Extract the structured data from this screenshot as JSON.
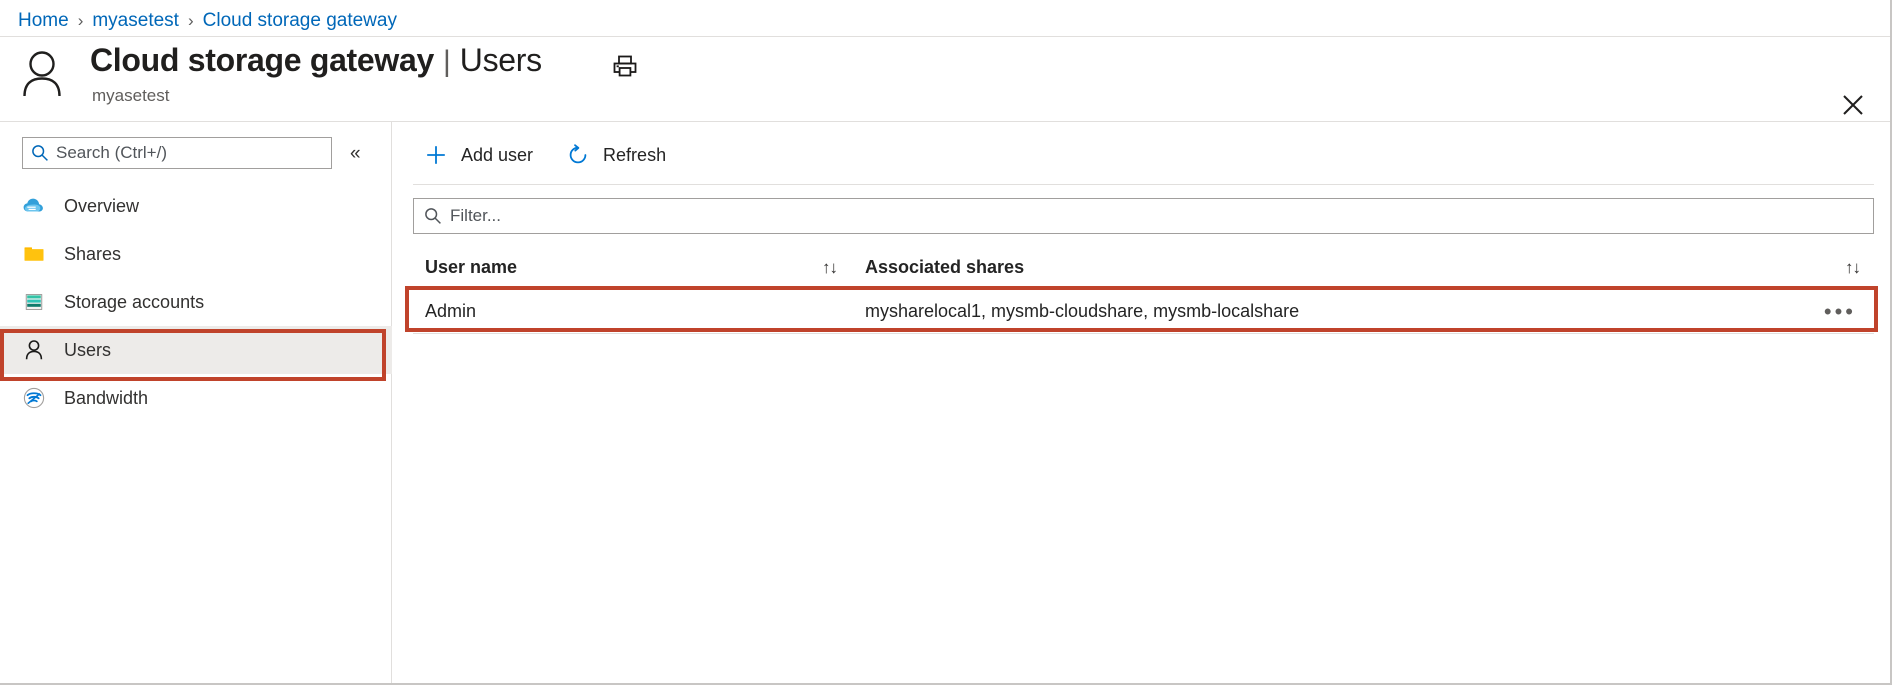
{
  "breadcrumb": {
    "items": [
      {
        "label": "Home"
      },
      {
        "label": "myasetest"
      },
      {
        "label": "Cloud storage gateway"
      }
    ],
    "separator": "›"
  },
  "header": {
    "avatar_icon": "user-icon",
    "title": "Cloud storage gateway",
    "pipe": "|",
    "section": "Users",
    "resource_name": "myasetest",
    "print_icon": "printer-icon",
    "close_icon": "close-icon"
  },
  "sidebar": {
    "search": {
      "placeholder": "Search (Ctrl+/)",
      "icon": "search-icon"
    },
    "collapse_label": "«",
    "items": [
      {
        "label": "Overview",
        "icon": "cloud-icon",
        "selected": false
      },
      {
        "label": "Shares",
        "icon": "folder-icon",
        "selected": false
      },
      {
        "label": "Storage accounts",
        "icon": "storage-account-icon",
        "selected": false
      },
      {
        "label": "Users",
        "icon": "user-icon",
        "selected": true
      },
      {
        "label": "Bandwidth",
        "icon": "bandwidth-icon",
        "selected": false
      }
    ]
  },
  "main": {
    "toolbar": {
      "add_user_label": "Add user",
      "add_user_icon": "plus-icon",
      "refresh_label": "Refresh",
      "refresh_icon": "refresh-icon"
    },
    "filter": {
      "placeholder": "Filter...",
      "icon": "search-icon"
    },
    "table": {
      "columns": [
        {
          "label": "User name",
          "sort_icon": "↑↓"
        },
        {
          "label": "Associated shares",
          "sort_icon": "↑↓"
        }
      ],
      "rows": [
        {
          "user_name": "Admin",
          "associated_shares": "mysharelocal1, mysmb-cloudshare, mysmb-localshare",
          "menu_label": "•••"
        }
      ]
    }
  },
  "annotations": {
    "highlight_color": "#c0432b"
  }
}
